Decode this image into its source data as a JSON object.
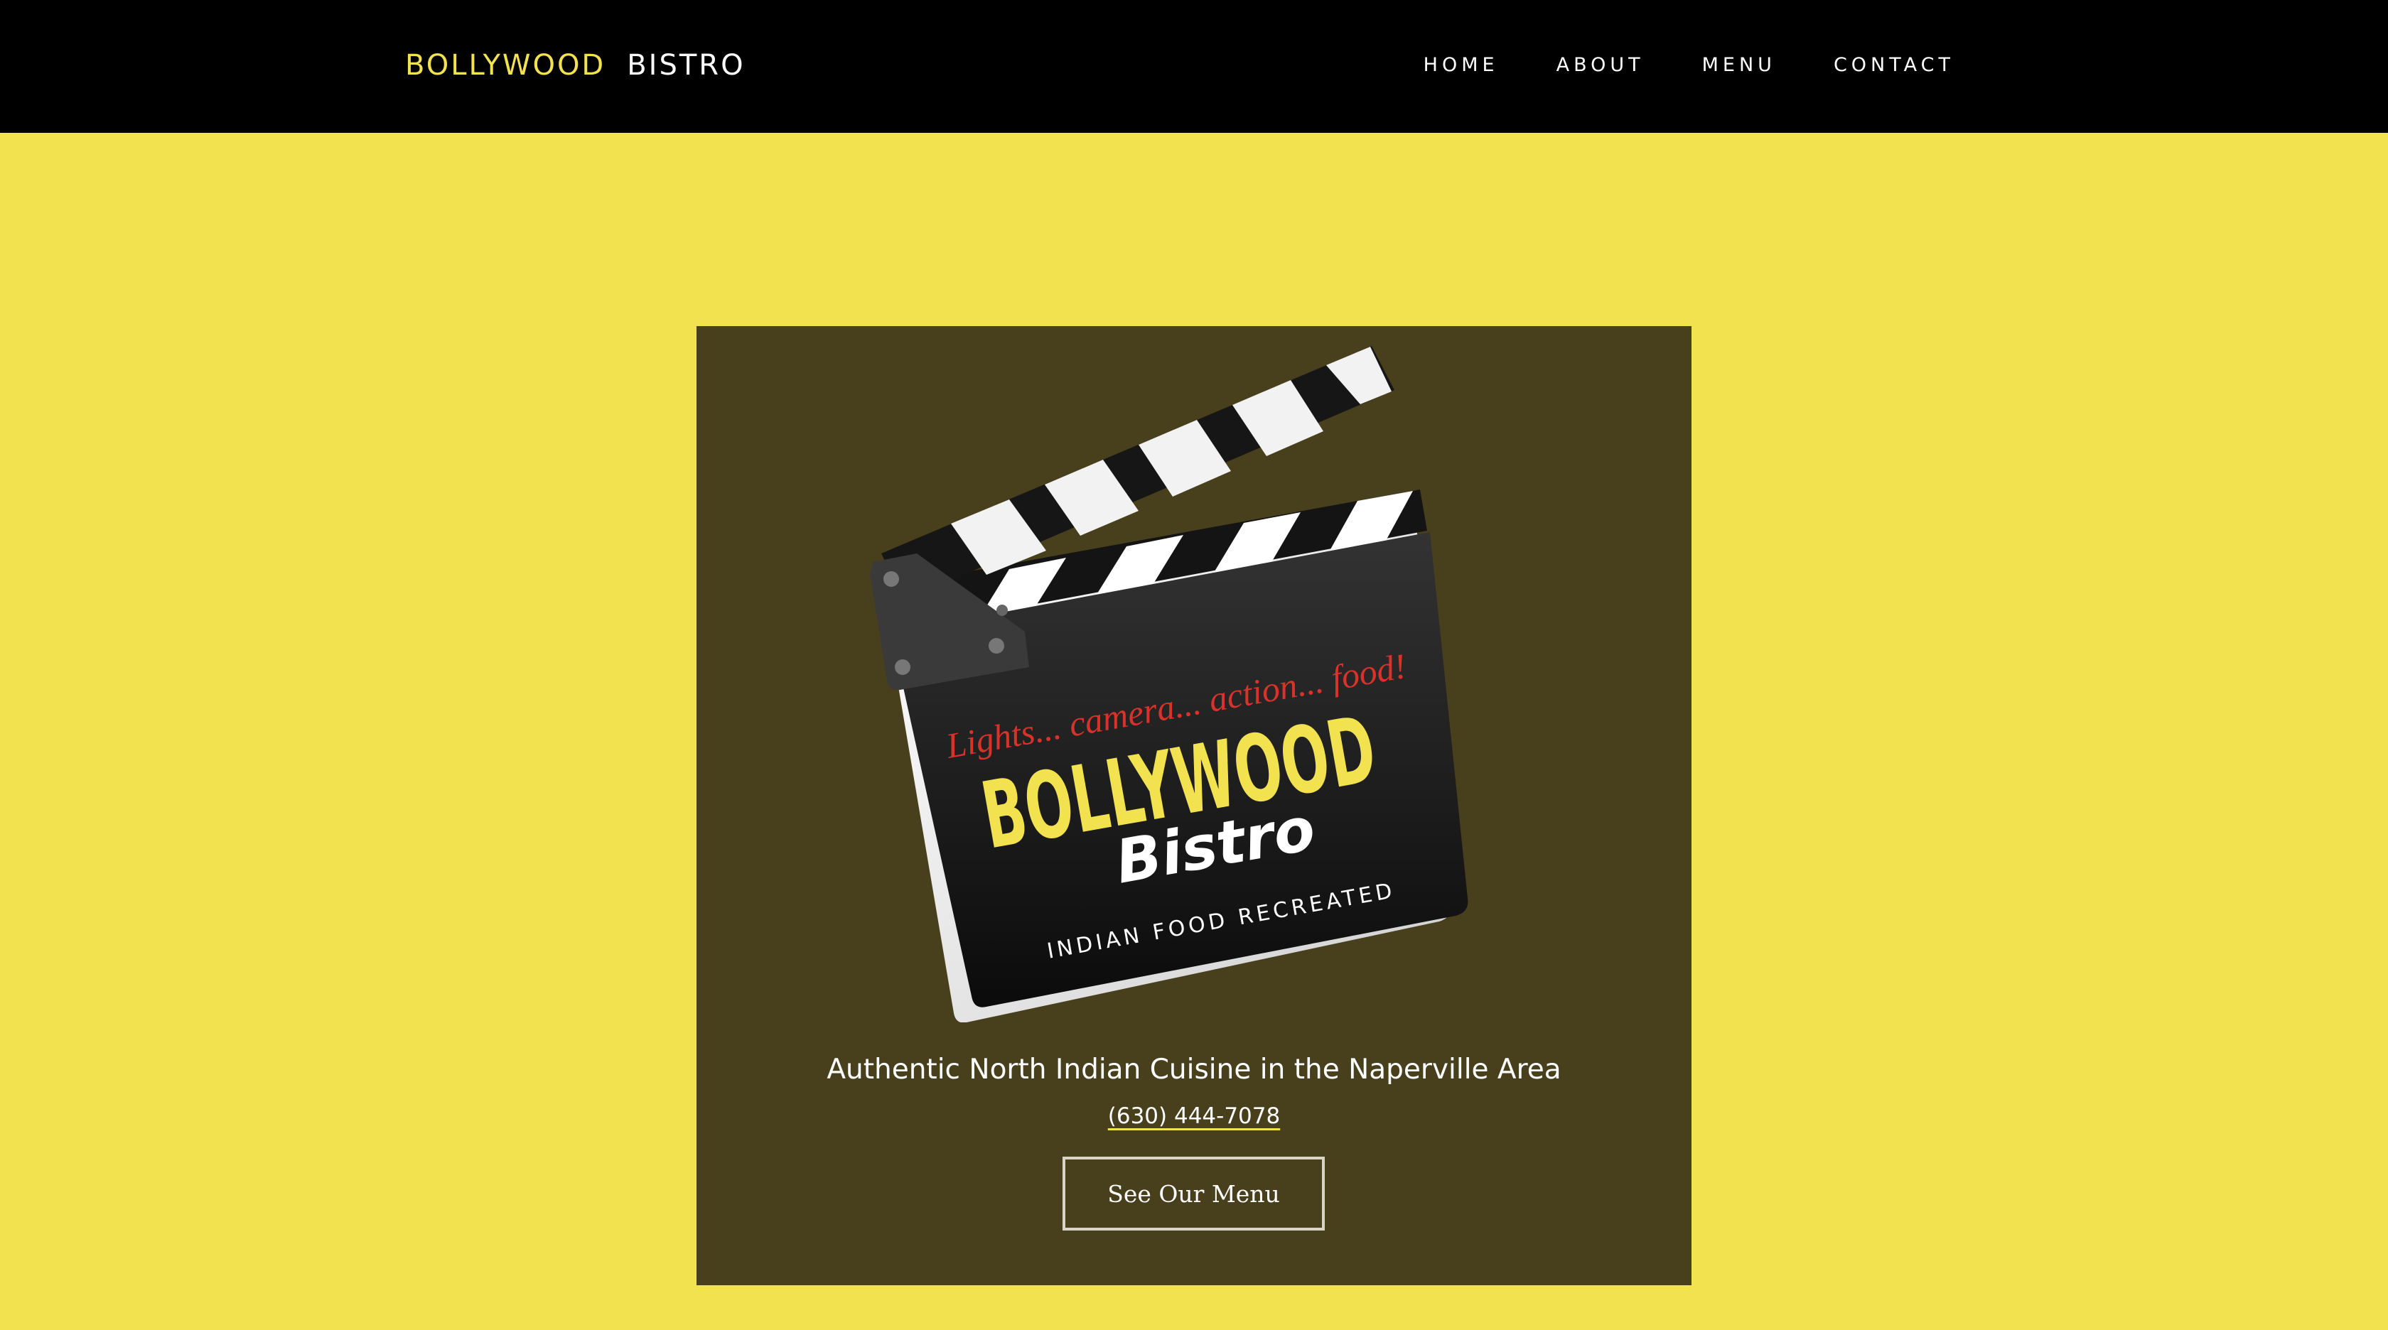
{
  "header": {
    "brand_part1": "BOLLYWOOD",
    "brand_part2": "BISTRO",
    "nav": [
      "HOME",
      "ABOUT",
      "MENU",
      "CONTACT"
    ]
  },
  "hero": {
    "logo": {
      "slogan": "Lights... camera... action... food!",
      "name_line1": "BOLLYWOOD",
      "name_line2": "Bistro",
      "subtitle": "INDIAN FOOD RECREATED"
    },
    "tagline": "Authentic North Indian Cuisine in the Naperville Area",
    "phone": "(630) 444-7078",
    "button_label": "See Our Menu"
  },
  "colors": {
    "page_background": "#f3e250",
    "header_background": "#000000",
    "panel_background": "#48401c",
    "brand_accent": "#f3e250",
    "slogan_red": "#d8322b"
  }
}
